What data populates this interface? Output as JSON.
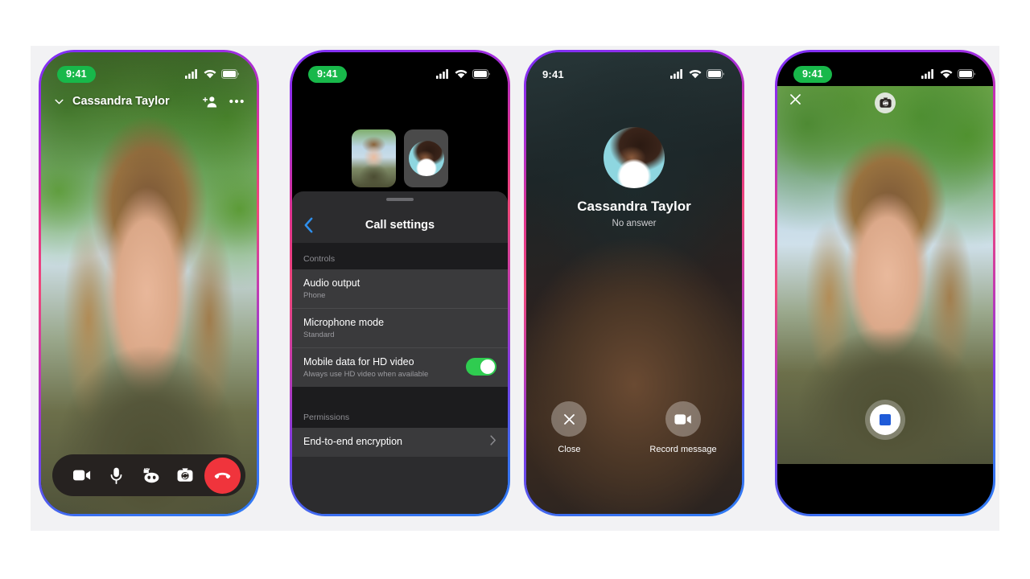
{
  "theme": {
    "page_bg": "#ffffff",
    "panel_bg": "#f2f2f4",
    "frame_gradient_start": "#7b2ff7",
    "frame_gradient_mid": "#e0338f",
    "frame_gradient_end": "#2f7df5",
    "accent_blue": "#2f8fec",
    "toggle_green": "#2fcc50",
    "end_call_red": "#f0343c",
    "status_pill_green": "#18b84a",
    "stop_square_blue": "#1f5bd8"
  },
  "phone1": {
    "status_bar": {
      "time": "9:41",
      "time_style": "green-pill",
      "icons": [
        "cellular-signal-icon",
        "wifi-icon",
        "battery-icon"
      ]
    },
    "header": {
      "collapse_icon": "chevron-down-icon",
      "title": "Cassandra Taylor",
      "add_person_icon": "add-person-icon",
      "more_icon": "more-options-icon"
    },
    "controls": [
      {
        "name": "video-toggle",
        "icon": "video-camera-icon"
      },
      {
        "name": "microphone-toggle",
        "icon": "microphone-icon"
      },
      {
        "name": "effects",
        "icon": "effects-mask-icon"
      },
      {
        "name": "flip-camera",
        "icon": "camera-flip-icon"
      },
      {
        "name": "end-call",
        "icon": "phone-hangup-icon"
      }
    ]
  },
  "phone2": {
    "status_bar": {
      "time": "9:41",
      "time_style": "green-pill",
      "icons": [
        "cellular-signal-icon",
        "wifi-icon",
        "battery-icon"
      ]
    },
    "tiles": [
      {
        "name": "self-video-tile",
        "kind": "video"
      },
      {
        "name": "peer-video-tile",
        "kind": "avatar"
      }
    ],
    "sheet": {
      "back_icon": "chevron-left-icon",
      "title": "Call settings",
      "sections": [
        {
          "header": "Controls",
          "rows": [
            {
              "title": "Audio output",
              "subtitle": "Phone",
              "accessory": "none"
            },
            {
              "title": "Microphone mode",
              "subtitle": "Standard",
              "accessory": "none"
            },
            {
              "title": "Mobile data for HD video",
              "subtitle": "Always use HD video when available",
              "accessory": "toggle",
              "toggle_on": true
            }
          ]
        },
        {
          "header": "Permissions",
          "rows": [
            {
              "title": "End-to-end encryption",
              "subtitle": "",
              "accessory": "chevron"
            }
          ]
        }
      ]
    }
  },
  "phone3": {
    "status_bar": {
      "time": "9:41",
      "time_style": "plain",
      "icons": [
        "cellular-signal-icon",
        "wifi-icon",
        "battery-icon"
      ]
    },
    "contact_name": "Cassandra Taylor",
    "call_status": "No answer",
    "actions": [
      {
        "label": "Close",
        "icon": "close-x-icon"
      },
      {
        "label": "Record message",
        "icon": "video-camera-icon"
      }
    ]
  },
  "phone4": {
    "status_bar": {
      "time": "9:41",
      "time_style": "green-pill",
      "icons": [
        "cellular-signal-icon",
        "wifi-icon",
        "battery-icon"
      ]
    },
    "close_icon": "close-x-icon",
    "flip_icon": "camera-flip-icon",
    "stop_button": {
      "name": "stop-recording-button",
      "icon": "stop-square-icon"
    }
  }
}
